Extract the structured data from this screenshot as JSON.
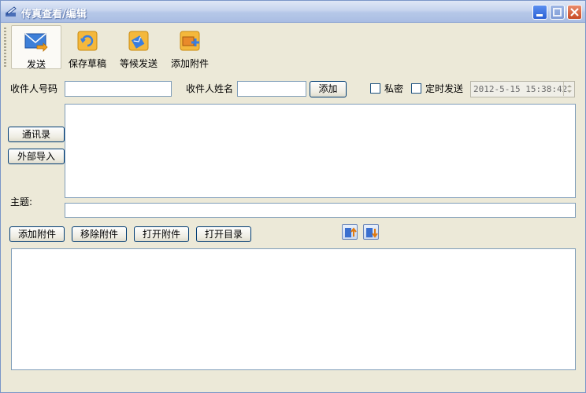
{
  "window": {
    "title": "传真查看/编辑"
  },
  "toolbar": {
    "send_label": "发送",
    "save_draft_label": "保存草稿",
    "wait_send_label": "等候发送",
    "add_attachment_label": "添加附件"
  },
  "form": {
    "recipient_number_label": "收件人号码",
    "recipient_number_value": "",
    "recipient_name_label": "收件人姓名",
    "recipient_name_value": "",
    "add_button": "添加",
    "private_label": "私密",
    "scheduled_label": "定时发送",
    "scheduled_datetime": "2012-5-15 15:38:42",
    "address_book_button": "通讯录",
    "external_import_button": "外部导入",
    "subject_label": "主题:",
    "subject_value": ""
  },
  "attachments": {
    "add_button": "添加附件",
    "remove_button": "移除附件",
    "open_button": "打开附件",
    "open_dir_button": "打开目录"
  },
  "colors": {
    "window_bg": "#ece9d8",
    "titlebar": "#b6c8e8",
    "button_border": "#003c74",
    "input_border": "#7f9db9"
  }
}
